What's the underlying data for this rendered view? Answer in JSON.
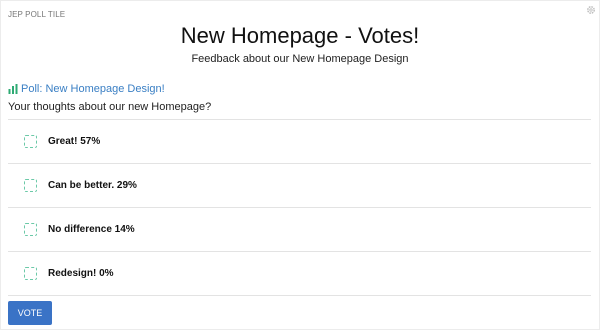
{
  "tile": {
    "label": "JEP POLL TILE",
    "settings_icon": "gear-icon"
  },
  "header": {
    "title": "New Homepage - Votes!",
    "subtitle": "Feedback about our New Homepage Design"
  },
  "poll": {
    "icon": "bar-chart-icon",
    "title": "Poll: New Homepage Design!",
    "question": "Your thoughts about our new Homepage?",
    "options": [
      {
        "label": "Great! 57%"
      },
      {
        "label": "Can be better. 29%"
      },
      {
        "label": "No difference 14%"
      },
      {
        "label": "Redesign! 0%"
      }
    ],
    "vote_label": "VOTE"
  },
  "colors": {
    "accent": "#3a73c6",
    "link": "#3a7fc4",
    "checkbox_border": "#6cc9a8",
    "chart_icon": "#2eaa73"
  }
}
